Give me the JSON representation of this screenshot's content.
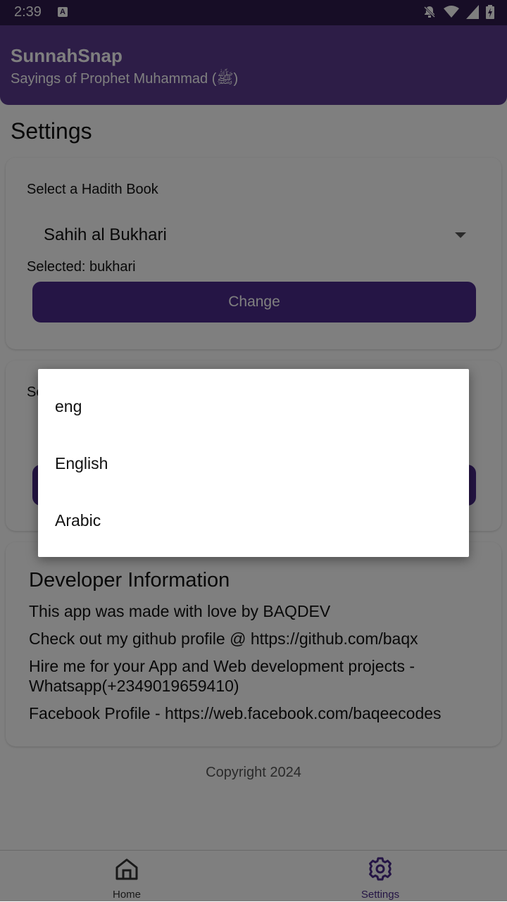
{
  "status_bar": {
    "time": "2:39",
    "icons": [
      "text-a-icon",
      "bell-off-icon",
      "wifi-icon",
      "signal-icon",
      "battery-charging-icon"
    ]
  },
  "header": {
    "title": "SunnahSnap",
    "subtitle": "Sayings of Prophet Muhammad (ﷺ)"
  },
  "page_title": "Settings",
  "book_card": {
    "label": "Select a Hadith Book",
    "selected_option": "Sahih al Bukhari",
    "selected_text": "Selected: bukhari",
    "button_label": "Change"
  },
  "language_card": {
    "label_partial": "Se"
  },
  "dropdown_menu": {
    "options": [
      "eng",
      "English",
      "Arabic"
    ]
  },
  "developer_card": {
    "heading": "Developer Information",
    "line1": "This app was made with love by BAQDEV",
    "line2": "Check out my github profile @ https://github.com/baqx",
    "line3": "Hire me for your App and Web development projects - Whatsapp(+2349019659410)",
    "line4": "Facebook Profile - https://web.facebook.com/baqeecodes"
  },
  "copyright": "Copyright 2024",
  "bottom_nav": {
    "home_label": "Home",
    "settings_label": "Settings",
    "active": "Settings"
  },
  "colors": {
    "primary": "#4a2a8a",
    "header": "#5a3a8f",
    "status_bar": "#2e1a4d",
    "scrim": "rgba(0,0,0,0.5)"
  }
}
